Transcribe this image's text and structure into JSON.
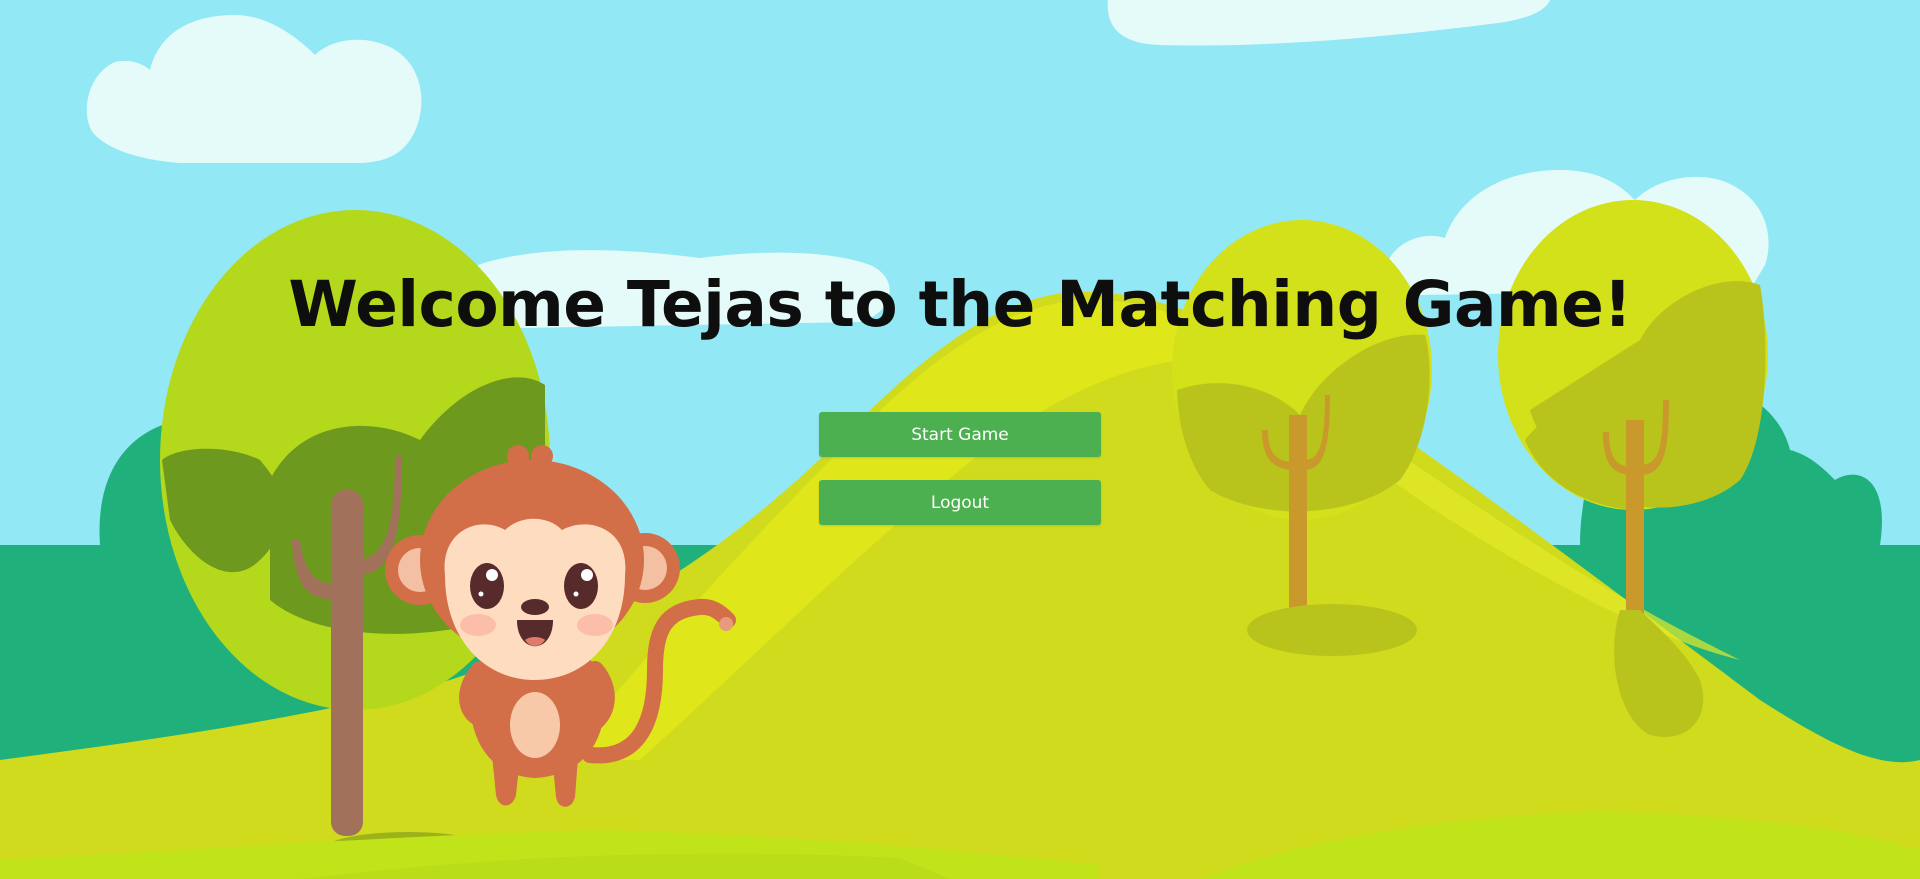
{
  "title_prefix": "Welcome ",
  "username": "Tejas",
  "title_suffix": " to the Matching Game!",
  "buttons": {
    "start_label": "Start Game",
    "logout_label": "Logout"
  },
  "colors": {
    "sky": "#93e8f5",
    "button": "#4caf50",
    "button_text": "#ffffff",
    "title_text": "#0e0e0e"
  },
  "illustration": {
    "character": "monkey",
    "elements": [
      "clouds",
      "trees",
      "hills",
      "grass"
    ]
  }
}
